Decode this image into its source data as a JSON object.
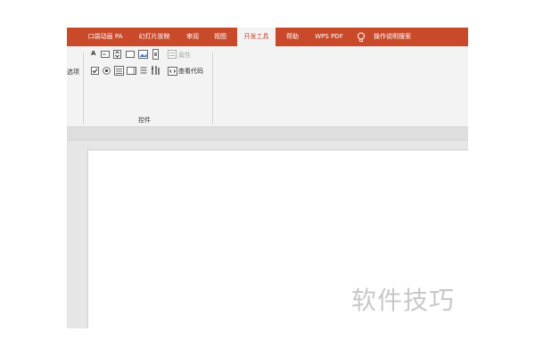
{
  "tabs": [
    {
      "label": "口袋动画 PA"
    },
    {
      "label": "幻灯片放映"
    },
    {
      "label": "审阅"
    },
    {
      "label": "视图"
    },
    {
      "label": "开发工具",
      "active": true
    },
    {
      "label": "帮助"
    },
    {
      "label": "WPS PDF"
    }
  ],
  "search": {
    "label": "操作说明搜索"
  },
  "ribbon": {
    "partial_group_label": "选项",
    "controls_group": {
      "label": "控件",
      "properties_label": "属性",
      "view_code_label": "查看代码"
    }
  },
  "watermark": "软件技巧",
  "colors": {
    "accent": "#c94a2b",
    "ribbon_bg": "#f3f3f3",
    "workspace_bg": "#e6e6e6"
  }
}
